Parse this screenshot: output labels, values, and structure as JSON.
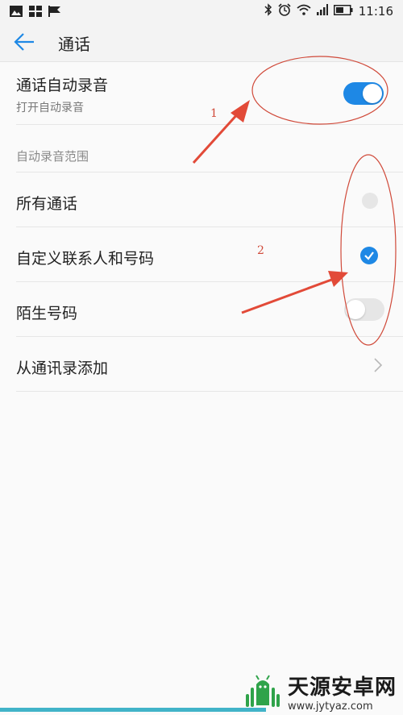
{
  "status_bar": {
    "time": "11:16",
    "left_icons": [
      "image-icon",
      "grid-app-icon",
      "flag-icon"
    ],
    "right_icons": [
      "bluetooth-icon",
      "alarm-icon",
      "wifi-icon",
      "signal-icon",
      "battery-icon"
    ]
  },
  "header": {
    "title": "通话",
    "back_icon": "back-arrow-icon"
  },
  "settings": {
    "auto_record": {
      "label": "通话自动录音",
      "sublabel": "打开自动录音",
      "enabled": true
    },
    "range_section_label": "自动录音范围",
    "options": [
      {
        "label": "所有通话",
        "control": "radio",
        "checked": false
      },
      {
        "label": "自定义联系人和号码",
        "control": "radio",
        "checked": true
      },
      {
        "label": "陌生号码",
        "control": "toggle",
        "checked": false
      }
    ],
    "add_from_contacts": {
      "label": "从通讯录添加",
      "icon": "chevron-right-icon"
    }
  },
  "annotations": {
    "marker_1": "1",
    "marker_2": "2"
  },
  "watermark": {
    "title": "天源安卓网",
    "url": "www.jytyaz.com"
  },
  "colors": {
    "accent": "#1e88e5",
    "annotation_red": "#d04a3a",
    "watermark_green": "#2fa34a"
  }
}
